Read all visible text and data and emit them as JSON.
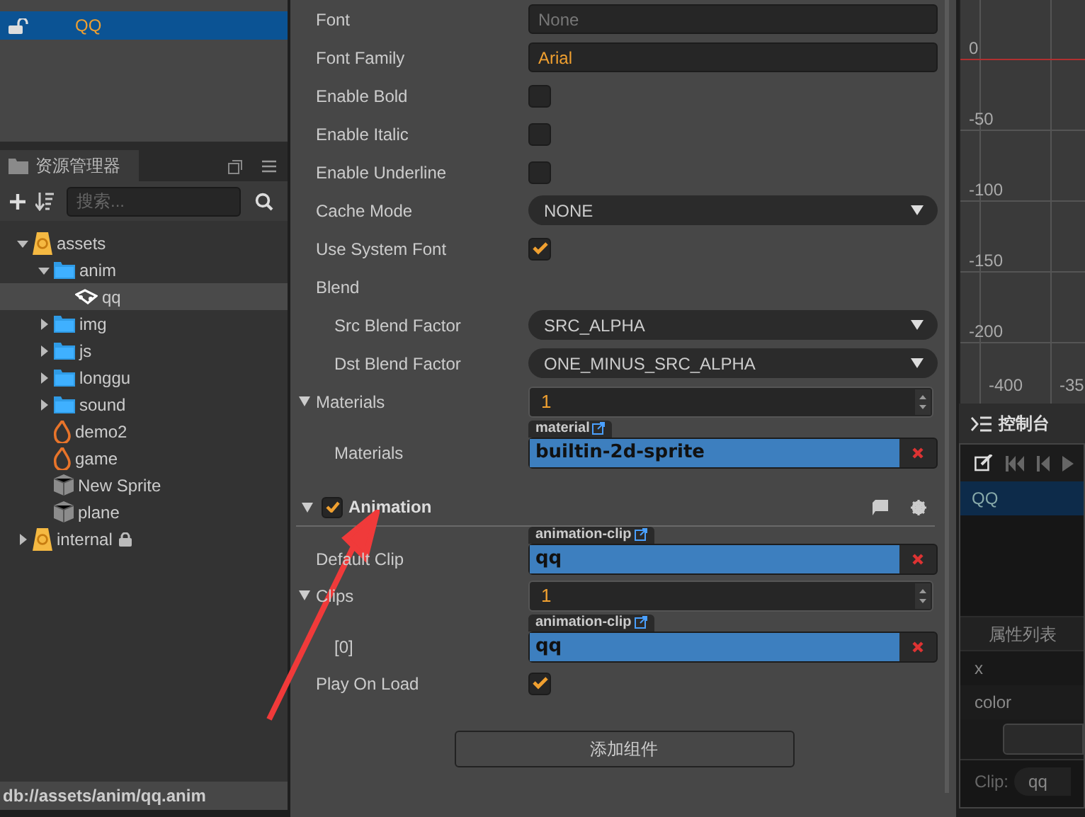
{
  "hierarchy": {
    "items": [
      {
        "label": "QQ",
        "selected": true
      }
    ]
  },
  "assets_panel": {
    "title": "资源管理器",
    "search": {
      "placeholder": "搜索..."
    },
    "tree": [
      {
        "label": "assets",
        "kind": "db",
        "locked": false,
        "expanded": true,
        "selected": false,
        "children": [
          {
            "label": "anim",
            "kind": "folder",
            "expanded": true,
            "selected": false,
            "children": [
              {
                "label": "qq",
                "kind": "clip",
                "selected": true
              }
            ]
          },
          {
            "label": "img",
            "kind": "folder",
            "expanded": false,
            "selected": false
          },
          {
            "label": "js",
            "kind": "folder",
            "expanded": false,
            "selected": false
          },
          {
            "label": "longgu",
            "kind": "folder",
            "expanded": false,
            "selected": false
          },
          {
            "label": "sound",
            "kind": "folder",
            "expanded": false,
            "selected": false
          },
          {
            "label": "demo2",
            "kind": "script",
            "selected": false
          },
          {
            "label": "game",
            "kind": "script",
            "selected": false
          },
          {
            "label": "New Sprite",
            "kind": "prefab",
            "selected": false
          },
          {
            "label": "plane",
            "kind": "prefab",
            "selected": false
          }
        ]
      },
      {
        "label": "internal",
        "kind": "db",
        "locked": true,
        "expanded": false,
        "selected": false
      }
    ],
    "status_bar": "db://assets/anim/qq.anim"
  },
  "inspector": {
    "components": [
      {
        "rows": [
          {
            "kind": "field",
            "label": "Font",
            "placeholder": "None"
          },
          {
            "kind": "field",
            "label": "Font Family",
            "value": "Arial"
          },
          {
            "kind": "checkbox",
            "label": "Enable Bold",
            "checked": false
          },
          {
            "kind": "checkbox",
            "label": "Enable Italic",
            "checked": false
          },
          {
            "kind": "checkbox",
            "label": "Enable Underline",
            "checked": false
          },
          {
            "kind": "select",
            "label": "Cache Mode",
            "value": "NONE"
          },
          {
            "kind": "checkbox",
            "label": "Use System Font",
            "checked": true
          },
          {
            "kind": "group",
            "label": "Blend",
            "children": [
              {
                "kind": "select",
                "label": "Src Blend Factor",
                "value": "SRC_ALPHA"
              },
              {
                "kind": "select",
                "label": "Dst Blend Factor",
                "value": "ONE_MINUS_SRC_ALPHA"
              }
            ]
          },
          {
            "kind": "number",
            "label": "Materials",
            "value": "1",
            "expanded": true,
            "children": [
              {
                "kind": "asset",
                "label": "Materials",
                "tag": "material",
                "value": "builtin-2d-sprite"
              }
            ]
          }
        ]
      },
      {
        "title": "Animation",
        "enabled": true,
        "expanded": true,
        "rows": [
          {
            "kind": "asset",
            "label": "Default Clip",
            "tag": "animation-clip",
            "value": "qq"
          },
          {
            "kind": "number",
            "label": "Clips",
            "value": "1",
            "expanded": true,
            "children": [
              {
                "kind": "asset",
                "label": "[0]",
                "tag": "animation-clip",
                "value": "qq"
              }
            ]
          },
          {
            "kind": "checkbox",
            "label": "Play On Load",
            "checked": true
          }
        ]
      }
    ],
    "add_component_button": "添加组件"
  },
  "scene": {
    "y_labels": [
      "0",
      "-50",
      "-100",
      "-150",
      "-200"
    ],
    "x_labels": [
      "-400",
      "-35"
    ]
  },
  "console": {
    "title": "控制台",
    "rows": [
      {
        "label": "QQ",
        "selected": true
      }
    ],
    "property_list_title": "属性列表",
    "properties": [
      "x",
      "color"
    ],
    "clip": {
      "label": "Clip:",
      "value": "qq"
    }
  }
}
